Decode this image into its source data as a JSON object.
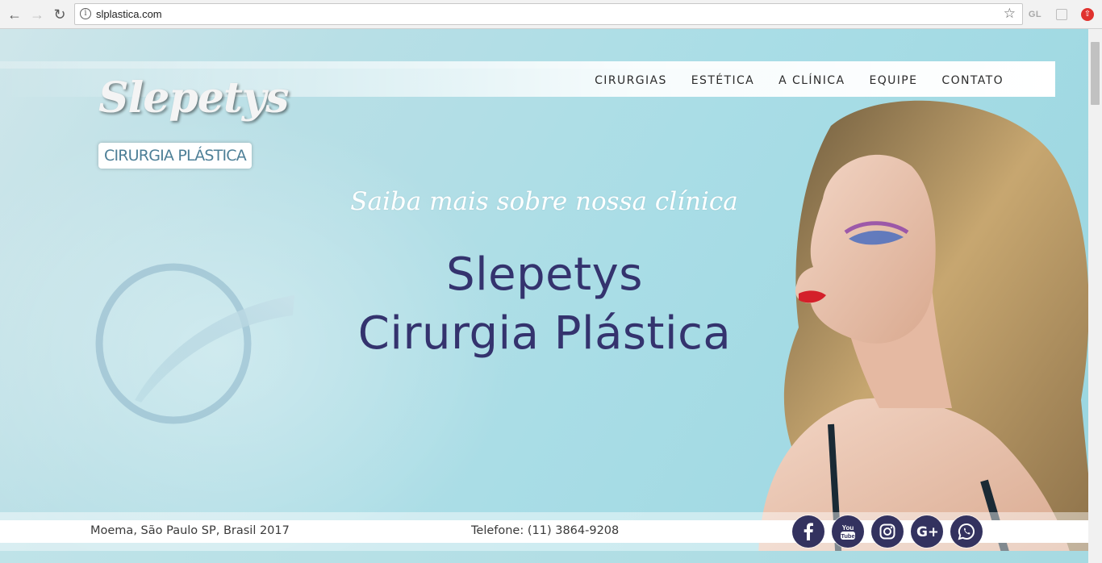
{
  "browser": {
    "url": "slplastica.com",
    "extensions": {
      "gl_label": "GL"
    }
  },
  "site": {
    "logo": {
      "script_text": "Slepetys",
      "badge_text": "CIRURGIA PLÁSTICA"
    },
    "menu": [
      "CIRURGIAS",
      "ESTÉTICA",
      "A CLÍNICA",
      "EQUIPE",
      "CONTATO"
    ],
    "hero": {
      "subtitle": "Saiba mais sobre nossa clínica",
      "title_line1": "Slepetys",
      "title_line2": "Cirurgia Plástica"
    },
    "footer": {
      "address": "Moema, São Paulo SP, Brasil 2017",
      "phone": "Telefone: (11) 3864-9208",
      "social": [
        {
          "name": "facebook-icon"
        },
        {
          "name": "youtube-icon",
          "label": "You Tube"
        },
        {
          "name": "instagram-icon"
        },
        {
          "name": "google-plus-icon",
          "label": "G+"
        },
        {
          "name": "whatsapp-icon"
        }
      ]
    },
    "colors": {
      "brand_navy": "#34336e",
      "social_bg": "#33325f",
      "background_teal": "#a9dde6",
      "logo_badge_text": "#4d7f97"
    }
  }
}
